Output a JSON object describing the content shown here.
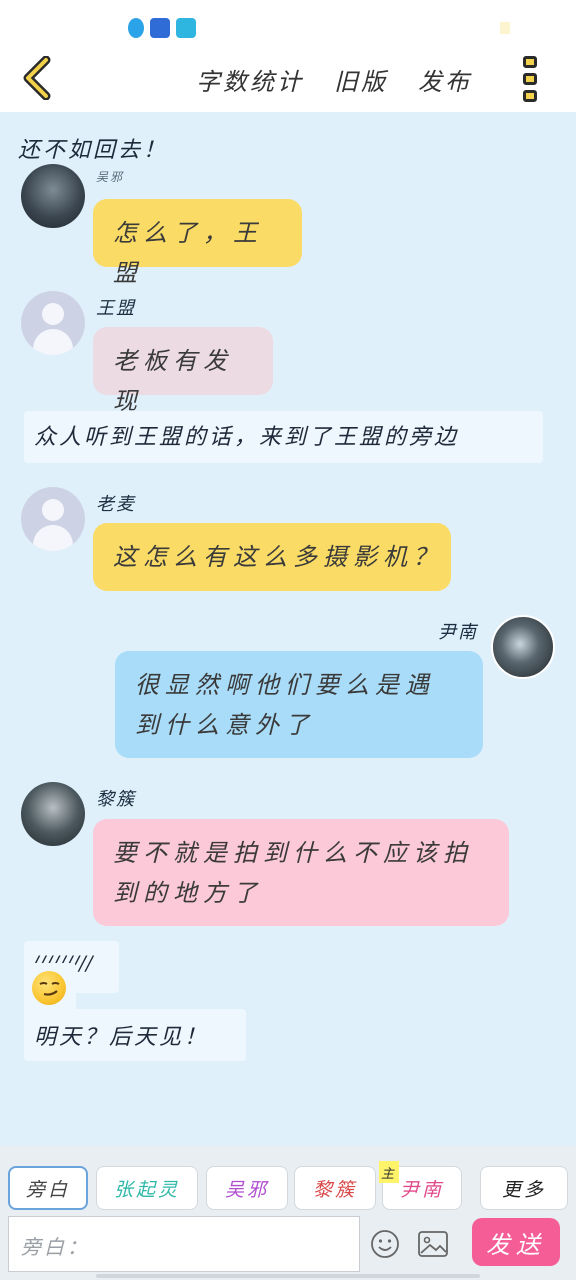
{
  "status_bar": {
    "icons": [
      "qq-icon",
      "baidu-icon",
      "video-icon"
    ]
  },
  "nav": {
    "actions": [
      "字数统计",
      "旧版",
      "发布"
    ],
    "icons": {
      "back": "chevron-left-icon",
      "more": "more-vertical-icon"
    }
  },
  "messages": [
    {
      "type": "narration",
      "text": "还不如回去！"
    },
    {
      "type": "message",
      "sender": "吴邪",
      "text": "怎么了，王盟"
    },
    {
      "type": "message",
      "sender": "王盟",
      "text": "老板有发现"
    },
    {
      "type": "narration",
      "text": "众人听到王盟的话，来到了王盟的旁边"
    },
    {
      "type": "message",
      "sender": "老麦",
      "text": "这怎么有这么多摄影机？"
    },
    {
      "type": "message",
      "sender": "尹南",
      "text": "很显然啊他们要么是遇到什么意外了"
    },
    {
      "type": "message",
      "sender": "黎簇",
      "text": "要不就是拍到什么不应该拍到的地方了"
    },
    {
      "type": "narration",
      "text": "/////////"
    },
    {
      "type": "narration",
      "text": "明天？后天见！"
    },
    {
      "type": "emoji",
      "icon": "smirk-emoji-icon"
    }
  ],
  "roles": [
    {
      "label": "旁白",
      "color": "#444444",
      "active": true
    },
    {
      "label": "张起灵",
      "color": "#2fb8a8"
    },
    {
      "label": "吴邪",
      "color": "#b04fd0"
    },
    {
      "label": "黎簇",
      "color": "#d84a4a"
    },
    {
      "label": "尹南",
      "color": "#e04a8a",
      "flag": "主"
    },
    {
      "label": "更多",
      "color": "#444444"
    }
  ],
  "composer": {
    "placeholder": "旁白：",
    "send_label": "发送",
    "icons": {
      "emoji": "smiley-icon",
      "image": "image-icon"
    }
  },
  "colors": {
    "chat_bg": "#dff0fb",
    "send_button": "#f55d97",
    "bubble_yellow": "#f9db66",
    "bubble_blue": "#a9dcf8",
    "bubble_pink": "#fcc9d9"
  }
}
